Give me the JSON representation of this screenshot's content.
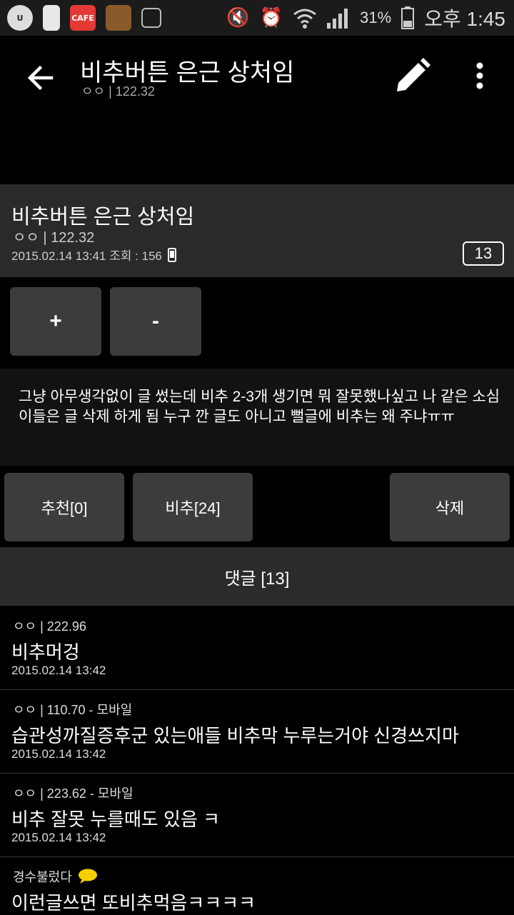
{
  "status_bar": {
    "battery": "31%",
    "time": "오후 1:45"
  },
  "toolbar": {
    "title": "비추버튼 은근 상처임",
    "subtitle": "ㅇㅇ | 122.32"
  },
  "post": {
    "title": "비추버튼 은근 상처임",
    "author": "ㅇㅇ | 122.32",
    "meta": "2015.02.14 13:41 조회 : 156",
    "comment_count": "13",
    "body": "그냥 아무생각없이 글 썼는데 비추 2-3개 생기면 뭐 잘못했나싶고 나 같은 소심이들은 글 삭제 하게 됨 누구 깐 글도 아니고 뻘글에 비추는 왜 주냐ㅠㅠ"
  },
  "actions": {
    "plus": "+",
    "minus": "-",
    "recommend": "추천[0]",
    "unrecommend": "비추[24]",
    "delete": "삭제"
  },
  "comments_header": "댓글 [13]",
  "comments": [
    {
      "author": "ㅇㅇ | 222.96",
      "body": "비추머겅",
      "date": "2015.02.14 13:42"
    },
    {
      "author": "ㅇㅇ | 110.70 - 모바일",
      "body": "습관성까질증후군 있는애들 비추막 누루는거야 신경쓰지마",
      "date": "2015.02.14 13:42"
    },
    {
      "author": "ㅇㅇ | 223.62 - 모바일",
      "body": "비추 잘못 누를때도 있음 ㅋ",
      "date": "2015.02.14 13:42"
    },
    {
      "author": "경수불렀다",
      "body": "이런글쓰면 또비추먹음ㅋㅋㅋㅋ",
      "date": ""
    }
  ],
  "colors": {
    "background": "#000000",
    "card": "#2a2a2a",
    "button": "#3c3c3c"
  }
}
